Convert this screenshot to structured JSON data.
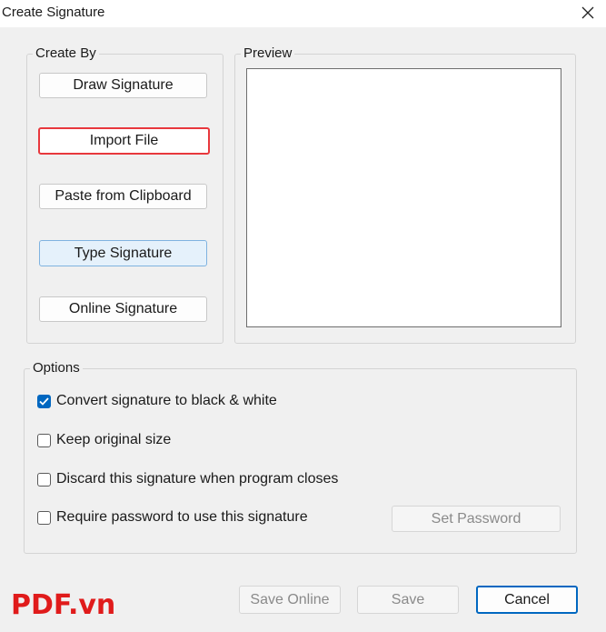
{
  "window": {
    "title": "Create Signature"
  },
  "create_by": {
    "legend": "Create By",
    "buttons": {
      "draw": "Draw Signature",
      "import": "Import File",
      "paste": "Paste from Clipboard",
      "type": "Type Signature",
      "online": "Online Signature"
    }
  },
  "preview": {
    "legend": "Preview"
  },
  "options": {
    "legend": "Options",
    "items": [
      {
        "label": "Convert signature to black & white",
        "checked": true
      },
      {
        "label": "Keep original size",
        "checked": false
      },
      {
        "label": "Discard this signature when program closes",
        "checked": false
      },
      {
        "label": "Require password to use this signature",
        "checked": false
      }
    ],
    "set_password": "Set Password"
  },
  "footer": {
    "save_online": "Save Online",
    "save": "Save",
    "cancel": "Cancel"
  },
  "watermark": {
    "part1": "PDF",
    "part2": ".vn"
  },
  "colors": {
    "accent": "#0067c0",
    "focus_border": "#e8383d",
    "watermark": "#e01b1b"
  }
}
